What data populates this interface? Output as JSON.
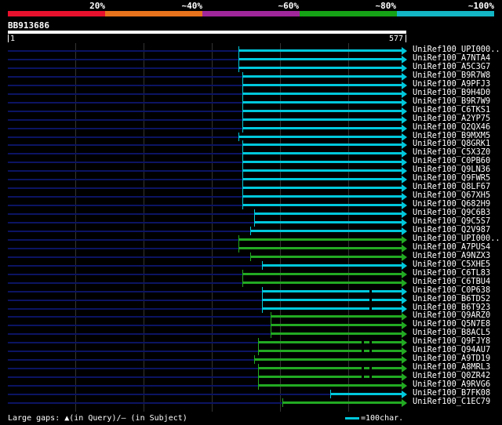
{
  "scale": {
    "segments": [
      {
        "color": "#e8112d"
      },
      {
        "color": "#e8731d"
      },
      {
        "color": "#a0279b"
      },
      {
        "color": "#16a216"
      },
      {
        "color": "#12b6c4"
      }
    ],
    "labels": [
      "20%",
      "~40%",
      "~60%",
      "~80%",
      "~100%"
    ]
  },
  "query": {
    "name": "BB913686",
    "start": "1",
    "end": "577"
  },
  "colors": {
    "cyan": "#00c8dc",
    "green": "#22aa22",
    "track": "#0b1462"
  },
  "hits": [
    {
      "name": "UniRef100_UPI000..",
      "from": 0.58,
      "to": 1.0,
      "color": "cyan",
      "dots": []
    },
    {
      "name": "UniRef100_A7NTA4",
      "from": 0.58,
      "to": 1.0,
      "color": "cyan",
      "dots": []
    },
    {
      "name": "UniRef100_A5C3G7",
      "from": 0.58,
      "to": 1.0,
      "color": "cyan",
      "dots": []
    },
    {
      "name": "UniRef100_B9R7W8",
      "from": 0.59,
      "to": 1.0,
      "color": "cyan",
      "dots": []
    },
    {
      "name": "UniRef100_A9PFJ3",
      "from": 0.59,
      "to": 1.0,
      "color": "cyan",
      "dots": []
    },
    {
      "name": "UniRef100_B9H4D0",
      "from": 0.59,
      "to": 1.0,
      "color": "cyan",
      "dots": []
    },
    {
      "name": "UniRef100_B9R7W9",
      "from": 0.59,
      "to": 1.0,
      "color": "cyan",
      "dots": []
    },
    {
      "name": "UniRef100_C6TKS1",
      "from": 0.59,
      "to": 1.0,
      "color": "cyan",
      "dots": []
    },
    {
      "name": "UniRef100_A2YP75",
      "from": 0.59,
      "to": 1.0,
      "color": "cyan",
      "dots": []
    },
    {
      "name": "UniRef100_Q2QX46",
      "from": 0.59,
      "to": 1.0,
      "color": "cyan",
      "dots": []
    },
    {
      "name": "UniRef100_B9MXM5",
      "from": 0.58,
      "to": 1.0,
      "color": "cyan",
      "dots": []
    },
    {
      "name": "UniRef100_Q8GRK1",
      "from": 0.59,
      "to": 1.0,
      "color": "cyan",
      "dots": []
    },
    {
      "name": "UniRef100_C5X3Z0",
      "from": 0.59,
      "to": 1.0,
      "color": "cyan",
      "dots": []
    },
    {
      "name": "UniRef100_C0PB60",
      "from": 0.59,
      "to": 1.0,
      "color": "cyan",
      "dots": []
    },
    {
      "name": "UniRef100_Q9LN36",
      "from": 0.59,
      "to": 1.0,
      "color": "cyan",
      "dots": []
    },
    {
      "name": "UniRef100_Q9FWR5",
      "from": 0.59,
      "to": 1.0,
      "color": "cyan",
      "dots": []
    },
    {
      "name": "UniRef100_Q8LF67",
      "from": 0.59,
      "to": 1.0,
      "color": "cyan",
      "dots": []
    },
    {
      "name": "UniRef100_Q67XH5",
      "from": 0.59,
      "to": 1.0,
      "color": "cyan",
      "dots": []
    },
    {
      "name": "UniRef100_Q682H9",
      "from": 0.59,
      "to": 1.0,
      "color": "cyan",
      "dots": []
    },
    {
      "name": "UniRef100_Q9C6B3",
      "from": 0.62,
      "to": 1.0,
      "color": "cyan",
      "dots": []
    },
    {
      "name": "UniRef100_Q9C5S7",
      "from": 0.62,
      "to": 1.0,
      "color": "cyan",
      "dots": []
    },
    {
      "name": "UniRef100_Q2V987",
      "from": 0.61,
      "to": 1.0,
      "color": "cyan",
      "dots": []
    },
    {
      "name": "UniRef100_UPI000..",
      "from": 0.58,
      "to": 1.0,
      "color": "green",
      "dots": []
    },
    {
      "name": "UniRef100_A7PUS4",
      "from": 0.58,
      "to": 1.0,
      "color": "green",
      "dots": []
    },
    {
      "name": "UniRef100_A9NZX3",
      "from": 0.61,
      "to": 1.0,
      "color": "green",
      "dots": []
    },
    {
      "name": "UniRef100_C5XHE5",
      "from": 0.64,
      "to": 1.0,
      "color": "cyan",
      "dots": []
    },
    {
      "name": "UniRef100_C6TL83",
      "from": 0.59,
      "to": 1.0,
      "color": "green",
      "dots": []
    },
    {
      "name": "UniRef100_C6TBU4",
      "from": 0.59,
      "to": 1.0,
      "color": "green",
      "dots": []
    },
    {
      "name": "UniRef100_C0P638",
      "from": 0.64,
      "to": 1.0,
      "color": "cyan",
      "dots": [
        0.91
      ]
    },
    {
      "name": "UniRef100_B6TDS2",
      "from": 0.64,
      "to": 1.0,
      "color": "cyan",
      "dots": [
        0.91
      ]
    },
    {
      "name": "UniRef100_B6T923",
      "from": 0.64,
      "to": 1.0,
      "color": "cyan",
      "dots": [
        0.91
      ]
    },
    {
      "name": "UniRef100_Q9ARZ0",
      "from": 0.66,
      "to": 1.0,
      "color": "green",
      "dots": []
    },
    {
      "name": "UniRef100_Q5N7E8",
      "from": 0.66,
      "to": 1.0,
      "color": "green",
      "dots": []
    },
    {
      "name": "UniRef100_B8ACL5",
      "from": 0.66,
      "to": 1.0,
      "color": "green",
      "dots": []
    },
    {
      "name": "UniRef100_Q9FJY8",
      "from": 0.63,
      "to": 1.0,
      "color": "green",
      "dots": [
        0.89,
        0.91
      ]
    },
    {
      "name": "UniRef100_Q94AU7",
      "from": 0.63,
      "to": 1.0,
      "color": "green",
      "dots": [
        0.89,
        0.91
      ]
    },
    {
      "name": "UniRef100_A9TD19",
      "from": 0.62,
      "to": 1.0,
      "color": "green",
      "dots": []
    },
    {
      "name": "UniRef100_A8MRL3",
      "from": 0.63,
      "to": 1.0,
      "color": "green",
      "dots": [
        0.89,
        0.91
      ]
    },
    {
      "name": "UniRef100_Q0ZR42",
      "from": 0.63,
      "to": 1.0,
      "color": "green",
      "dots": [
        0.89,
        0.91
      ]
    },
    {
      "name": "UniRef100_A9RVG6",
      "from": 0.63,
      "to": 1.0,
      "color": "green",
      "dots": []
    },
    {
      "name": "UniRef100_B7FK08",
      "from": 0.81,
      "to": 1.0,
      "color": "cyan",
      "dots": []
    },
    {
      "name": "UniRef100_C1EC79",
      "from": 0.69,
      "to": 1.0,
      "color": "green",
      "dots": []
    }
  ],
  "footer": {
    "text": "Large gaps: ▲(in Query)/– (in Subject)",
    "legend": "=100char."
  }
}
